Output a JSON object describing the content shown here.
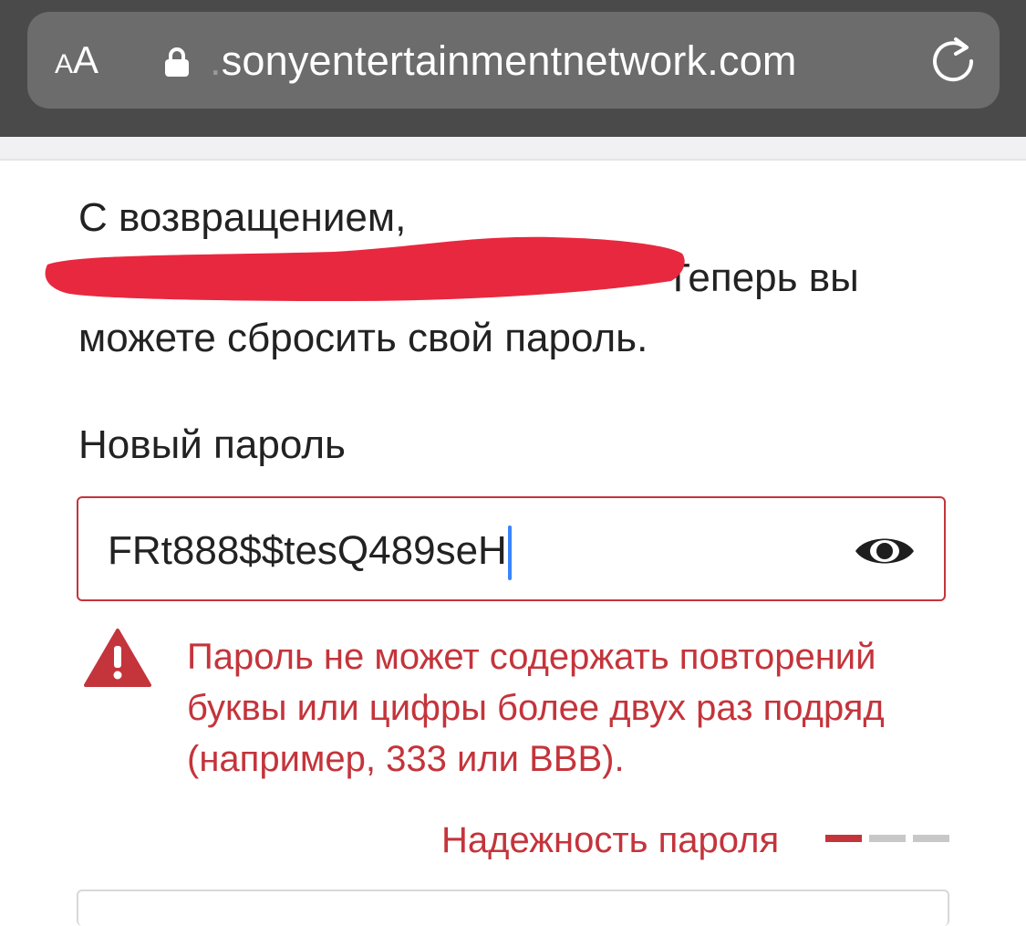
{
  "browser": {
    "text_size_button": {
      "small": "A",
      "large": "A"
    },
    "url_prefix": ".",
    "url_domain": "sonyentertainmentnetwork.com",
    "lock_icon": "lock-icon",
    "reload_icon": "reload-icon"
  },
  "page": {
    "intro_line1": "С возвращением,",
    "intro_line2_visible": "Теперь вы",
    "intro_line3": "можете сбросить свой пароль.",
    "new_password_label": "Новый пароль",
    "password_value": "FRt888$$tesQ489seH",
    "show_password_icon": "eye-icon",
    "warning_icon": "warning-triangle-icon",
    "error_message": "Пароль не может содержать повторений буквы или цифры более двух раз подряд (например, 333 или BBB).",
    "strength_label": "Надежность пароля",
    "strength_segments_filled": 1,
    "strength_segments_total": 3
  },
  "colors": {
    "error": "#c4343b",
    "caret": "#3a85ff",
    "redaction": "#e8283f",
    "chrome_bg": "#4a4a4a",
    "urlbar_bg": "#6c6c6c"
  }
}
